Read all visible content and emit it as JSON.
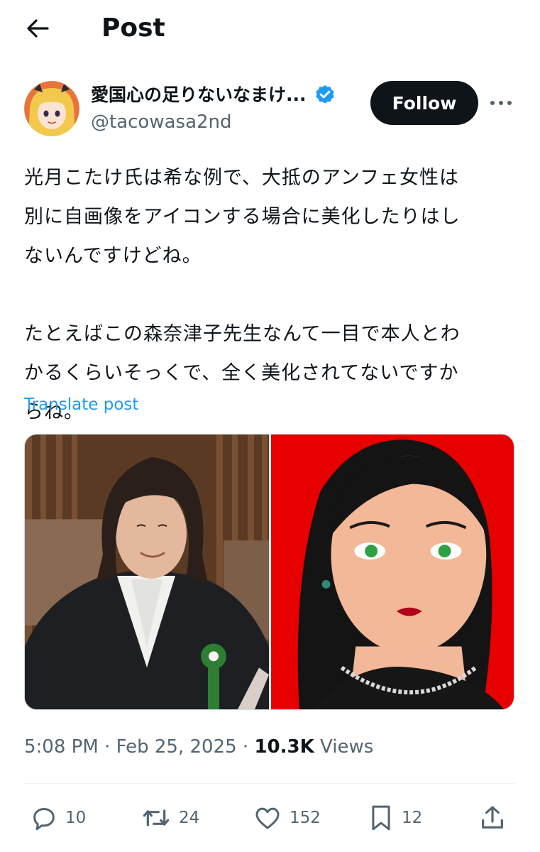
{
  "header": {
    "title": "Post"
  },
  "author": {
    "display_name": "愛国心の足りないなまけ...",
    "handle": "@tacowasa2nd",
    "follow_label": "Follow"
  },
  "post": {
    "text": "光月こたけ氏は希な例で、大抵のアンフェ女性は\n別に自画像をアイコンする場合に美化したりはし\nないんですけどね。\n\nたとえばこの森奈津子先生なんて一目で本人とわ\nかるくらいそっくで、全く美化されてないですか\nらね。",
    "translate_label": "Translate post"
  },
  "meta": {
    "time": "5:08 PM",
    "date": "Feb 25, 2025",
    "separator": "·",
    "views_count": "10.3K",
    "views_label": "Views"
  },
  "actions": {
    "replies": "10",
    "reposts": "24",
    "likes": "152",
    "bookmarks": "12"
  },
  "colors": {
    "text": "#0f1419",
    "secondary": "#536471",
    "link": "#1d9bf0",
    "follow_bg": "#0f1419",
    "verified": "#1d9bf0"
  }
}
